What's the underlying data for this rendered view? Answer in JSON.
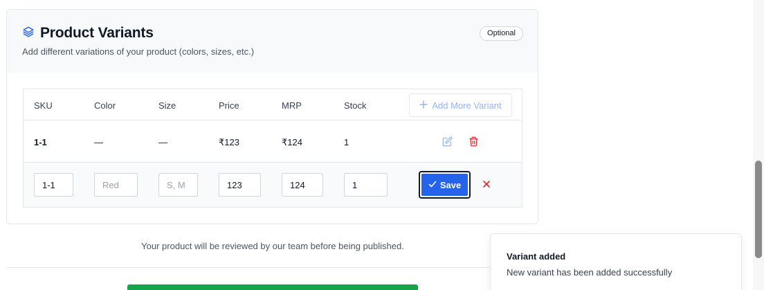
{
  "section": {
    "title": "Product Variants",
    "subtitle": "Add different variations of your product (colors, sizes, etc.)",
    "badge": "Optional",
    "icon": "layers-icon"
  },
  "table": {
    "headers": [
      "SKU",
      "Color",
      "Size",
      "Price",
      "MRP",
      "Stock"
    ],
    "add_button_label": "Add More Variant",
    "rows": [
      {
        "sku": "1-1",
        "color": "—",
        "size": "—",
        "price": "₹123",
        "mrp": "₹124",
        "stock": "1"
      }
    ],
    "edit_row": {
      "sku_value": "1-1",
      "color_value": "",
      "color_placeholder": "Red",
      "size_value": "",
      "size_placeholder": "S, M",
      "price_value": "123",
      "mrp_value": "124",
      "stock_value": "1",
      "save_label": "Save"
    }
  },
  "footer": {
    "notice": "Your product will be reviewed by our team before being published."
  },
  "toast": {
    "title": "Variant added",
    "description": "New variant has been added successfully"
  },
  "colors": {
    "accent": "#2563eb",
    "danger": "#dc2626",
    "success": "#16a34a",
    "edit_icon": "#93b4f5"
  }
}
